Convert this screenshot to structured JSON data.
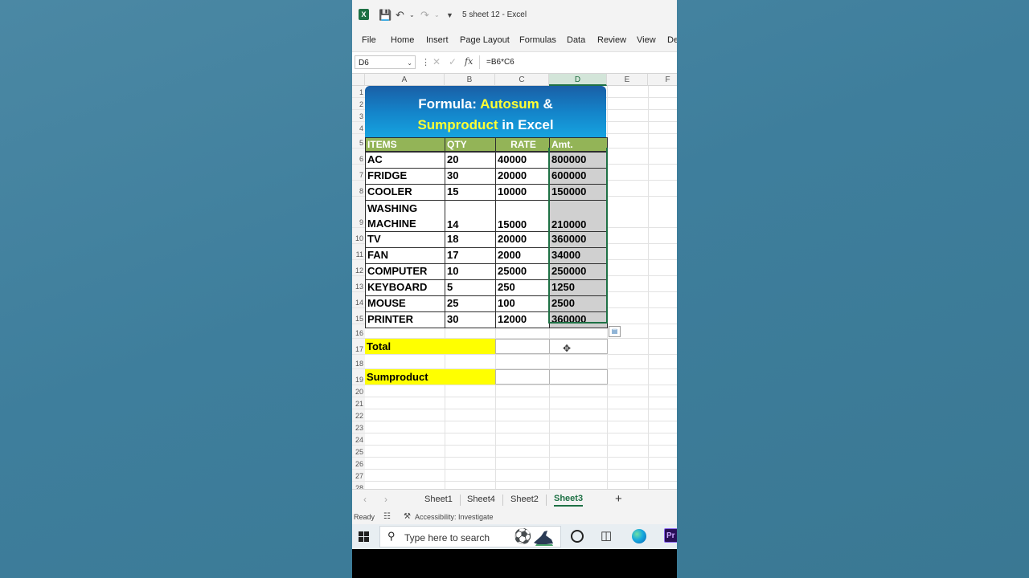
{
  "titlebar": {
    "doc_title": "5 sheet 12  -  Excel",
    "app_letter": "X"
  },
  "ribbon_tabs": [
    "File",
    "Home",
    "Insert",
    "Page Layout",
    "Formulas",
    "Data",
    "Review",
    "View",
    "De"
  ],
  "formula_bar": {
    "name_box": "D6",
    "fx_label": "fx",
    "formula": "=B6*C6"
  },
  "columns": [
    "A",
    "B",
    "C",
    "D",
    "E",
    "F"
  ],
  "selected_column": "D",
  "rows": [
    "1",
    "2",
    "3",
    "4",
    "5",
    "6",
    "7",
    "8",
    "9",
    "10",
    "11",
    "12",
    "13",
    "14",
    "15",
    "16",
    "17",
    "18",
    "19",
    "20",
    "21",
    "22",
    "23",
    "24",
    "25",
    "26",
    "27",
    "28"
  ],
  "banner": {
    "line1_prefix": "Formula: ",
    "line1_highlight": "Autosum",
    "line1_suffix": " &",
    "line2_highlight": "Sumproduct",
    "line2_suffix": " in Excel"
  },
  "table": {
    "headers": [
      "ITEMS",
      "QTY",
      "RATE",
      "Amt."
    ],
    "rows": [
      [
        "AC",
        "20",
        "40000",
        "800000"
      ],
      [
        "FRIDGE",
        "30",
        "20000",
        "600000"
      ],
      [
        "COOLER",
        "15",
        "10000",
        "150000"
      ],
      [
        "WASHING",
        "14",
        "15000",
        "210000"
      ],
      [
        "TV",
        "18",
        "20000",
        "360000"
      ],
      [
        "FAN",
        "17",
        "2000",
        "34000"
      ],
      [
        "COMPUTER",
        "10",
        "25000",
        "250000"
      ],
      [
        "KEYBOARD",
        "5",
        "250",
        "1250"
      ],
      [
        "MOUSE",
        "25",
        "100",
        "2500"
      ],
      [
        "PRINTER",
        "30",
        "12000",
        "360000"
      ]
    ],
    "washing_line2": "MACHINE"
  },
  "total_label": "Total",
  "sumproduct_label": "Sumproduct",
  "sheet_tabs": [
    "Sheet1",
    "Sheet4",
    "Sheet2",
    "Sheet3"
  ],
  "active_sheet": "Sheet3",
  "status": {
    "ready": "Ready",
    "accessibility": "Accessibility: Investigate"
  },
  "taskbar": {
    "search_placeholder": "Type here to search",
    "premiere_label": "Pr"
  }
}
